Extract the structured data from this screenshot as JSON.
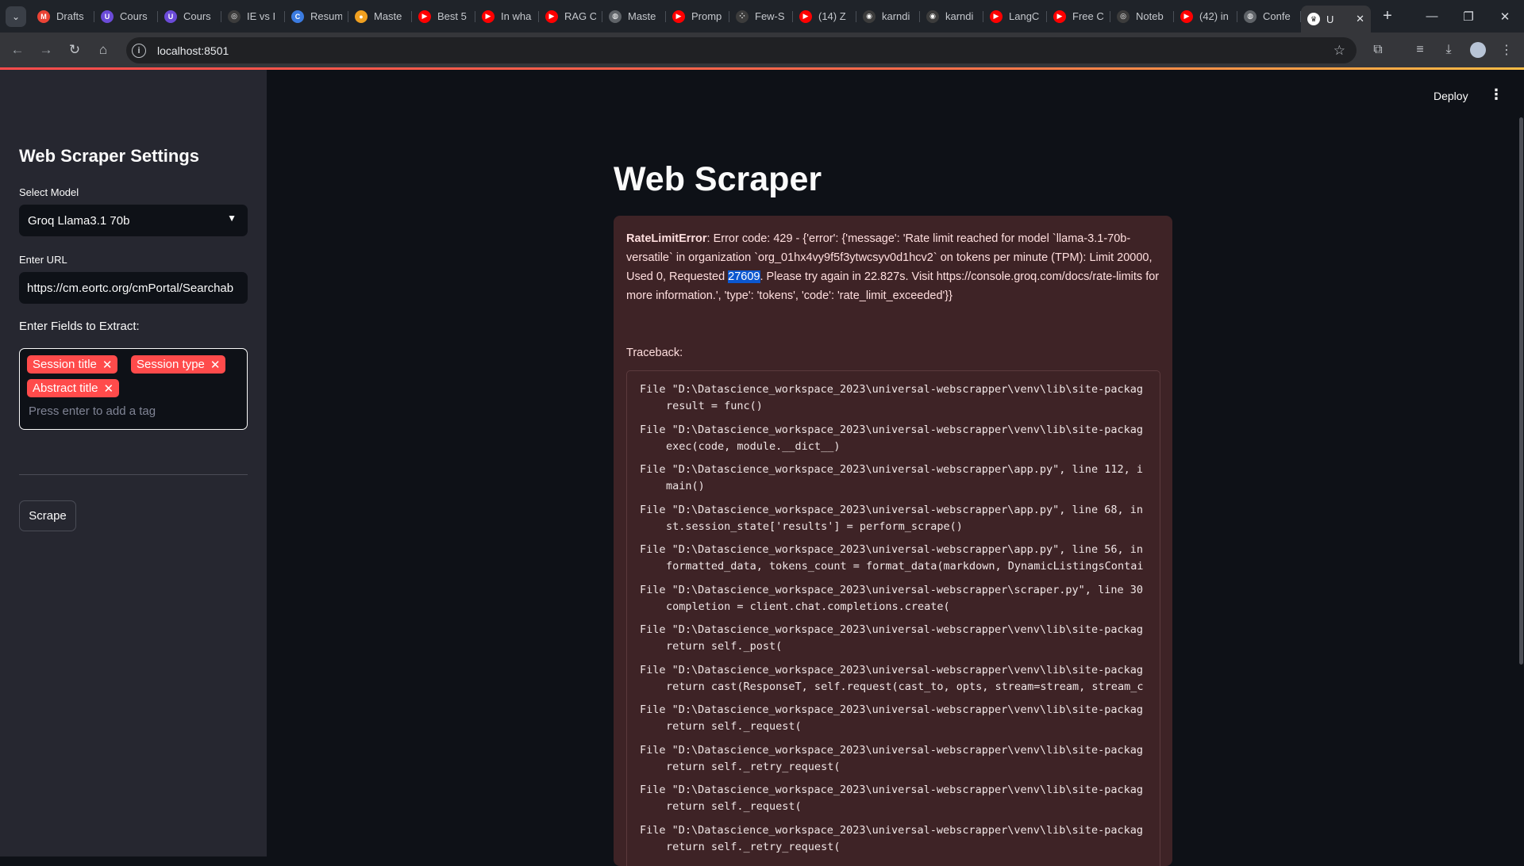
{
  "browser": {
    "tabs": [
      {
        "title": "Drafts",
        "icon": "gmail-icon",
        "color": "#ea4335",
        "glyph": "M"
      },
      {
        "title": "Cours",
        "icon": "course-icon",
        "color": "#6b4bd8",
        "glyph": "U"
      },
      {
        "title": "Cours",
        "icon": "course-icon",
        "color": "#6b4bd8",
        "glyph": "U"
      },
      {
        "title": "IE vs I",
        "icon": "openai-icon",
        "color": "#3c3c3c",
        "glyph": "◎"
      },
      {
        "title": "Resum",
        "icon": "resume-icon",
        "color": "#3b7be0",
        "glyph": "C"
      },
      {
        "title": "Maste",
        "icon": "site-icon",
        "color": "#f0a020",
        "glyph": "●"
      },
      {
        "title": "Best 5",
        "icon": "youtube-icon",
        "color": "#ff0000",
        "glyph": "▶"
      },
      {
        "title": "In wha",
        "icon": "youtube-icon",
        "color": "#ff0000",
        "glyph": "▶"
      },
      {
        "title": "RAG C",
        "icon": "youtube-icon",
        "color": "#ff0000",
        "glyph": "▶"
      },
      {
        "title": "Maste",
        "icon": "globe-icon",
        "color": "#5f6368",
        "glyph": "◍"
      },
      {
        "title": "Promp",
        "icon": "youtube-icon",
        "color": "#ff0000",
        "glyph": "▶"
      },
      {
        "title": "Few-S",
        "icon": "dots-icon",
        "color": "#3c3c3c",
        "glyph": "⁘"
      },
      {
        "title": "(14) Z",
        "icon": "youtube-icon",
        "color": "#ff0000",
        "glyph": "▶"
      },
      {
        "title": "karndi",
        "icon": "github-icon",
        "color": "#3c3c3c",
        "glyph": "◉"
      },
      {
        "title": "karndi",
        "icon": "github-icon",
        "color": "#3c3c3c",
        "glyph": "◉"
      },
      {
        "title": "LangC",
        "icon": "youtube-icon",
        "color": "#ff0000",
        "glyph": "▶"
      },
      {
        "title": "Free C",
        "icon": "youtube-icon",
        "color": "#ff0000",
        "glyph": "▶"
      },
      {
        "title": "Noteb",
        "icon": "openai-icon",
        "color": "#3c3c3c",
        "glyph": "◎"
      },
      {
        "title": "(42) in",
        "icon": "youtube-icon",
        "color": "#ff0000",
        "glyph": "▶"
      },
      {
        "title": "Confe",
        "icon": "globe-icon",
        "color": "#5f6368",
        "glyph": "◍"
      }
    ],
    "active_tab": {
      "title": "U",
      "icon": "streamlit-icon"
    },
    "url": "localhost:8501"
  },
  "sidebar": {
    "title": "Web Scraper Settings",
    "model_label": "Select Model",
    "model_value": "Groq Llama3.1 70b",
    "url_label": "Enter URL",
    "url_value": "https://cm.eortc.org/cmPortal/Searchab",
    "fields_label": "Enter Fields to Extract:",
    "tags": [
      "Session title",
      "Session type",
      "Abstract title"
    ],
    "tag_placeholder": "Press enter to add a tag",
    "scrape_label": "Scrape"
  },
  "header": {
    "deploy_label": "Deploy"
  },
  "main": {
    "title": "Web Scraper",
    "error": {
      "type": "RateLimitError",
      "message_before": ": Error code: 429 - {'error': {'message': 'Rate limit reached for model `llama-3.1-70b-versatile` in organization `org_01hx4vy9f5f3ytwcsyv0d1hcv2` on tokens per minute (TPM): Limit 20000, Used 0, Requested ",
      "highlight": "27609",
      "message_after": ". Please try again in 22.827s. Visit https://console.groq.com/docs/rate-limits for more information.', 'type': 'tokens', 'code': 'rate_limit_exceeded'}}",
      "traceback_label": "Traceback:",
      "frames": [
        {
          "file": "File \"D:\\Datascience_workspace_2023\\universal-webscrapper\\venv\\lib\\site-packag",
          "code": "result = func()"
        },
        {
          "file": "File \"D:\\Datascience_workspace_2023\\universal-webscrapper\\venv\\lib\\site-packag",
          "code": "exec(code, module.__dict__)"
        },
        {
          "file": "File \"D:\\Datascience_workspace_2023\\universal-webscrapper\\app.py\", line 112, i",
          "code": "main()"
        },
        {
          "file": "File \"D:\\Datascience_workspace_2023\\universal-webscrapper\\app.py\", line 68, in",
          "code": "st.session_state['results'] = perform_scrape()"
        },
        {
          "file": "File \"D:\\Datascience_workspace_2023\\universal-webscrapper\\app.py\", line 56, in",
          "code": "formatted_data, tokens_count = format_data(markdown, DynamicListingsContai"
        },
        {
          "file": "File \"D:\\Datascience_workspace_2023\\universal-webscrapper\\scraper.py\", line 30",
          "code": "completion = client.chat.completions.create("
        },
        {
          "file": "File \"D:\\Datascience_workspace_2023\\universal-webscrapper\\venv\\lib\\site-packag",
          "code": "return self._post("
        },
        {
          "file": "File \"D:\\Datascience_workspace_2023\\universal-webscrapper\\venv\\lib\\site-packag",
          "code": "return cast(ResponseT, self.request(cast_to, opts, stream=stream, stream_c"
        },
        {
          "file": "File \"D:\\Datascience_workspace_2023\\universal-webscrapper\\venv\\lib\\site-packag",
          "code": "return self._request("
        },
        {
          "file": "File \"D:\\Datascience_workspace_2023\\universal-webscrapper\\venv\\lib\\site-packag",
          "code": "return self._retry_request("
        },
        {
          "file": "File \"D:\\Datascience_workspace_2023\\universal-webscrapper\\venv\\lib\\site-packag",
          "code": "return self._request("
        },
        {
          "file": "File \"D:\\Datascience_workspace_2023\\universal-webscrapper\\venv\\lib\\site-packag",
          "code": "return self._retry_request("
        }
      ]
    }
  }
}
